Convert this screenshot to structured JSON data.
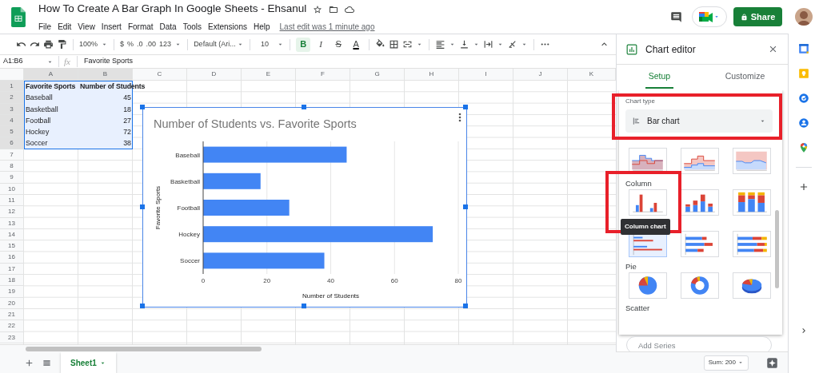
{
  "document": {
    "title": "How To Create A Bar Graph In Google Sheets - Ehsanul",
    "last_edit": "Last edit was 1 minute ago"
  },
  "menu": [
    "File",
    "Edit",
    "View",
    "Insert",
    "Format",
    "Data",
    "Tools",
    "Extensions",
    "Help"
  ],
  "share_button": "Share",
  "toolbar": {
    "zoom": "100%",
    "currency": "$",
    "percent": "%",
    "decimal_decrease": ".0",
    "decimal_increase": ".00",
    "number_format": "123",
    "font": "Default (Ari...",
    "font_size": "10",
    "text_styles": [
      {
        "kind": "bold",
        "label": "B",
        "on": true
      },
      {
        "kind": "italic",
        "label": "I",
        "on": false
      },
      {
        "kind": "strikethrough",
        "label": "S",
        "on": false
      },
      {
        "kind": "text-color",
        "label": "A",
        "on": false
      }
    ]
  },
  "formula_bar": {
    "name_box": "A1:B6",
    "fx": "fx",
    "value": "Favorite Sports"
  },
  "sheet": {
    "columns": [
      {
        "label": "A",
        "selected": true
      },
      {
        "label": "B",
        "selected": true
      },
      {
        "label": "C",
        "selected": false
      },
      {
        "label": "D",
        "selected": false
      },
      {
        "label": "E",
        "selected": false
      },
      {
        "label": "F",
        "selected": false
      },
      {
        "label": "G",
        "selected": false
      },
      {
        "label": "H",
        "selected": false
      },
      {
        "label": "I",
        "selected": false
      },
      {
        "label": "J",
        "selected": false
      },
      {
        "label": "K",
        "selected": false
      }
    ],
    "rows": [
      {
        "label": "1",
        "selected": true,
        "cells": [
          {
            "text": "Favorite Sports",
            "kind": "text",
            "bold": true
          },
          {
            "text": "Number of Students",
            "kind": "text",
            "bold": true
          }
        ]
      },
      {
        "label": "2",
        "selected": true,
        "cells": [
          {
            "text": "Baseball",
            "kind": "text",
            "bold": false
          },
          {
            "text": "45",
            "kind": "number",
            "bold": false
          }
        ]
      },
      {
        "label": "3",
        "selected": true,
        "cells": [
          {
            "text": "Basketball",
            "kind": "text",
            "bold": false
          },
          {
            "text": "18",
            "kind": "number",
            "bold": false
          }
        ]
      },
      {
        "label": "4",
        "selected": true,
        "cells": [
          {
            "text": "Football",
            "kind": "text",
            "bold": false
          },
          {
            "text": "27",
            "kind": "number",
            "bold": false
          }
        ]
      },
      {
        "label": "5",
        "selected": true,
        "cells": [
          {
            "text": "Hockey",
            "kind": "text",
            "bold": false
          },
          {
            "text": "72",
            "kind": "number",
            "bold": false
          }
        ]
      },
      {
        "label": "6",
        "selected": true,
        "cells": [
          {
            "text": "Soccer",
            "kind": "text",
            "bold": false
          },
          {
            "text": "38",
            "kind": "number",
            "bold": false
          }
        ]
      },
      {
        "label": "7",
        "selected": false
      },
      {
        "label": "8",
        "selected": false
      },
      {
        "label": "9",
        "selected": false
      },
      {
        "label": "10",
        "selected": false
      },
      {
        "label": "11",
        "selected": false
      },
      {
        "label": "12",
        "selected": false
      },
      {
        "label": "13",
        "selected": false
      },
      {
        "label": "14",
        "selected": false
      },
      {
        "label": "15",
        "selected": false
      },
      {
        "label": "16",
        "selected": false
      },
      {
        "label": "17",
        "selected": false
      },
      {
        "label": "18",
        "selected": false
      },
      {
        "label": "19",
        "selected": false
      },
      {
        "label": "20",
        "selected": false
      },
      {
        "label": "21",
        "selected": false
      },
      {
        "label": "22",
        "selected": false
      },
      {
        "label": "23",
        "selected": false
      }
    ]
  },
  "chart": {
    "chart_data": {
      "type": "bar",
      "orientation": "horizontal",
      "title": "Number of Students vs. Favorite Sports",
      "xlabel": "Number of Students",
      "ylabel": "Favorite Sports",
      "categories": [
        "Baseball",
        "Basketball",
        "Football",
        "Hockey",
        "Soccer"
      ],
      "series": [
        {
          "color": "#4285f4",
          "values": [
            45,
            18,
            27,
            72,
            38
          ]
        }
      ],
      "grid": true,
      "xlim": [
        0,
        80
      ],
      "xticks": [
        0,
        20,
        40,
        60,
        80
      ]
    }
  },
  "chart_editor": {
    "title": "Chart editor",
    "tabs": [
      {
        "label": "Setup",
        "selected": true
      },
      {
        "label": "Customize",
        "selected": false
      }
    ],
    "chart_type_label": "Chart type",
    "chart_type": "Bar chart",
    "groups": [
      {
        "thumbnails": [
          {
            "kind": "stepped-area",
            "selected": false
          },
          {
            "kind": "stepped-area-stacked",
            "selected": false
          },
          {
            "kind": "area-100",
            "selected": false
          }
        ]
      },
      {
        "label": "Column",
        "thumbnails": [
          {
            "kind": "column",
            "selected": false,
            "tooltip": "Column chart"
          },
          {
            "kind": "column-stacked",
            "selected": false
          },
          {
            "kind": "column-100",
            "selected": false
          }
        ]
      },
      {
        "thumbnails": [
          {
            "kind": "bar",
            "selected": true
          },
          {
            "kind": "bar-stacked",
            "selected": false
          },
          {
            "kind": "bar-100",
            "selected": false
          }
        ]
      },
      {
        "label": "Pie",
        "thumbnails": [
          {
            "kind": "pie",
            "selected": false
          },
          {
            "kind": "donut",
            "selected": false
          },
          {
            "kind": "pie-3d",
            "selected": false
          }
        ]
      },
      {
        "label": "Scatter"
      }
    ],
    "add_series": "Add Series"
  },
  "bottom_bar": {
    "sheets": [
      {
        "label": "Sheet1",
        "selected": true
      }
    ],
    "sum": "Sum: 200"
  }
}
